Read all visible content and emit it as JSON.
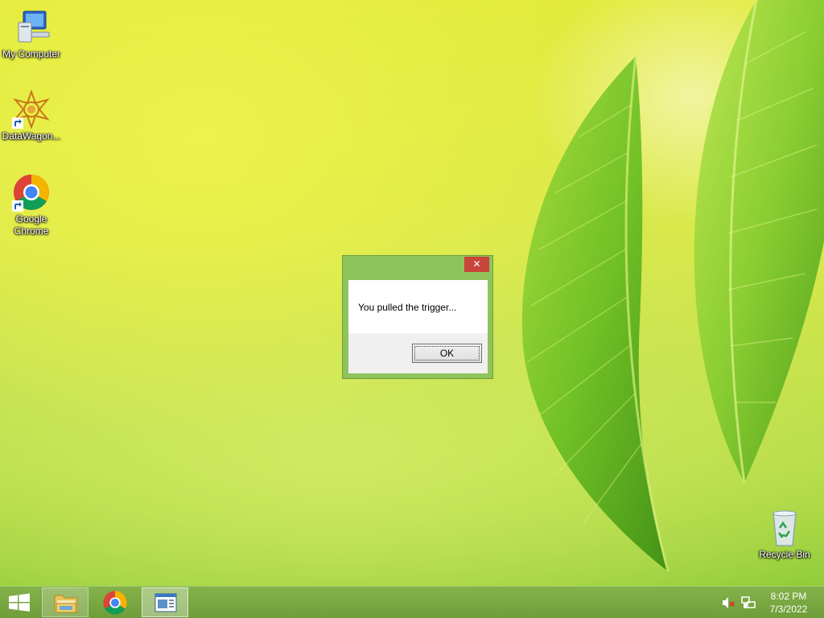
{
  "desktop": {
    "icons": [
      {
        "label": "My Computer"
      },
      {
        "label": "DataWagon..."
      },
      {
        "label": "Google Chrome"
      },
      {
        "label": "Recycle Bin"
      }
    ]
  },
  "dialog": {
    "close_glyph": "✕",
    "message": "You pulled the trigger...",
    "ok_label": "OK"
  },
  "taskbar": {
    "start_icon": "windows-logo-icon",
    "pinned": [
      {
        "name": "file-explorer",
        "icon": "folder-icon"
      },
      {
        "name": "google-chrome",
        "icon": "chrome-icon"
      },
      {
        "name": "active-app",
        "icon": "window-icon"
      }
    ],
    "tray": {
      "volume_icon": "volume-muted-icon",
      "network_icon": "network-icon",
      "time": "8:02 PM",
      "date": "7/3/2022"
    }
  },
  "colors": {
    "dialog_frame": "#8fc45c",
    "close_button": "#c7453a",
    "taskbar": "#7aa843"
  }
}
